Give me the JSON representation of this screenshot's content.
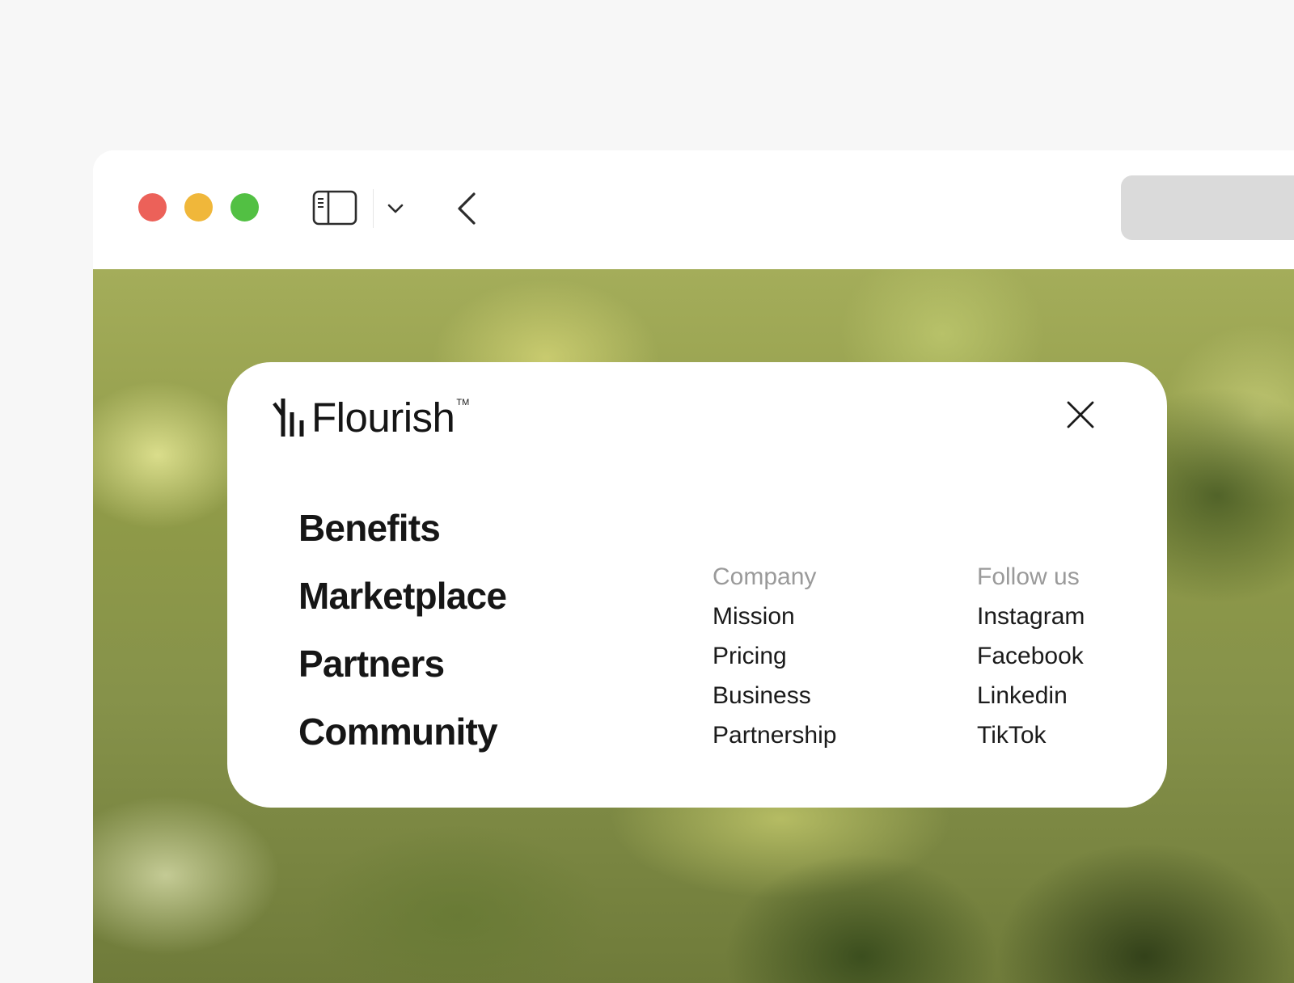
{
  "browser": {
    "traffic_lights": [
      "close",
      "minimize",
      "zoom"
    ],
    "icons": [
      "sidebar-toggle-icon",
      "chevron-down-icon",
      "back-arrow-icon"
    ]
  },
  "menu": {
    "logo_text": "Flourish",
    "logo_tm": "TM",
    "close_icon": "close-icon",
    "primary_links": [
      "Benefits",
      "Marketplace",
      "Partners",
      "Community"
    ],
    "company": {
      "heading": "Company",
      "links": [
        "Mission",
        "Pricing",
        "Business",
        "Partnership"
      ]
    },
    "follow": {
      "heading": "Follow us",
      "links": [
        "Instagram",
        "Facebook",
        "Linkedin",
        "TikTok"
      ]
    }
  },
  "colors": {
    "close_light": "#ec6159",
    "minimize_light": "#f0b73a",
    "zoom_light": "#52c043",
    "text_primary": "#161616",
    "text_muted": "#9a9a9a",
    "address_bar": "#dadada"
  }
}
